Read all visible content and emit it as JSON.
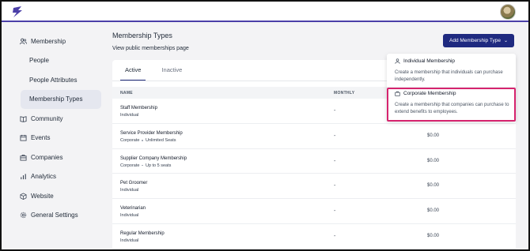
{
  "app": {
    "logo_icon": "lightning-logo-icon",
    "avatar_icon": "user-avatar",
    "accent": "#1f2a80",
    "highlight": "#d6246e"
  },
  "sidebar": {
    "items": [
      {
        "label": "Membership",
        "icon": "users-icon",
        "sub": false,
        "active": false
      },
      {
        "label": "People",
        "icon": "",
        "sub": true,
        "active": false
      },
      {
        "label": "People Attributes",
        "icon": "",
        "sub": true,
        "active": false
      },
      {
        "label": "Membership Types",
        "icon": "",
        "sub": true,
        "active": true
      },
      {
        "label": "Community",
        "icon": "book-icon",
        "sub": false,
        "active": false
      },
      {
        "label": "Events",
        "icon": "calendar-icon",
        "sub": false,
        "active": false
      },
      {
        "label": "Companies",
        "icon": "briefcase-icon",
        "sub": false,
        "active": false
      },
      {
        "label": "Analytics",
        "icon": "bar-chart-icon",
        "sub": false,
        "active": false
      },
      {
        "label": "Website",
        "icon": "cube-icon",
        "sub": false,
        "active": false
      },
      {
        "label": "General Settings",
        "icon": "gear-icon",
        "sub": false,
        "active": false
      }
    ]
  },
  "main": {
    "title": "Membership Types",
    "public_link": "View public memberships page",
    "add_button": "Add Membership Type",
    "tabs": [
      {
        "label": "Active",
        "active": true
      },
      {
        "label": "Inactive",
        "active": false
      }
    ],
    "table": {
      "columns": [
        "NAME",
        "MONTHLY"
      ],
      "rows": [
        {
          "name": "Staff Membership",
          "meta": [
            "Individual"
          ],
          "monthly": "-",
          "price": ""
        },
        {
          "name": "Service Provider Membership",
          "meta": [
            "Corporate",
            "Unlimited Seats"
          ],
          "monthly": "-",
          "price": "$0.00"
        },
        {
          "name": "Supplier Company Membership",
          "meta": [
            "Corporate",
            "Up to 5 seats"
          ],
          "monthly": "-",
          "price": "$0.00"
        },
        {
          "name": "Pet Groomer",
          "meta": [
            "Individual"
          ],
          "monthly": "-",
          "price": "$0.00"
        },
        {
          "name": "Veterinarian",
          "meta": [
            "Individual"
          ],
          "monthly": "-",
          "price": "$0.00"
        },
        {
          "name": "Regular Membership",
          "meta": [
            "Individual"
          ],
          "monthly": "-",
          "price": "$0.00"
        }
      ]
    }
  },
  "dropdown": {
    "items": [
      {
        "title": "Individual Membership",
        "icon": "person-icon",
        "desc": "Create a membership that individuals can purchase independently."
      },
      {
        "title": "Corporate Membership",
        "icon": "building-icon",
        "desc": "Create a membership that companies can purchase to extend benefits to employees."
      }
    ]
  }
}
